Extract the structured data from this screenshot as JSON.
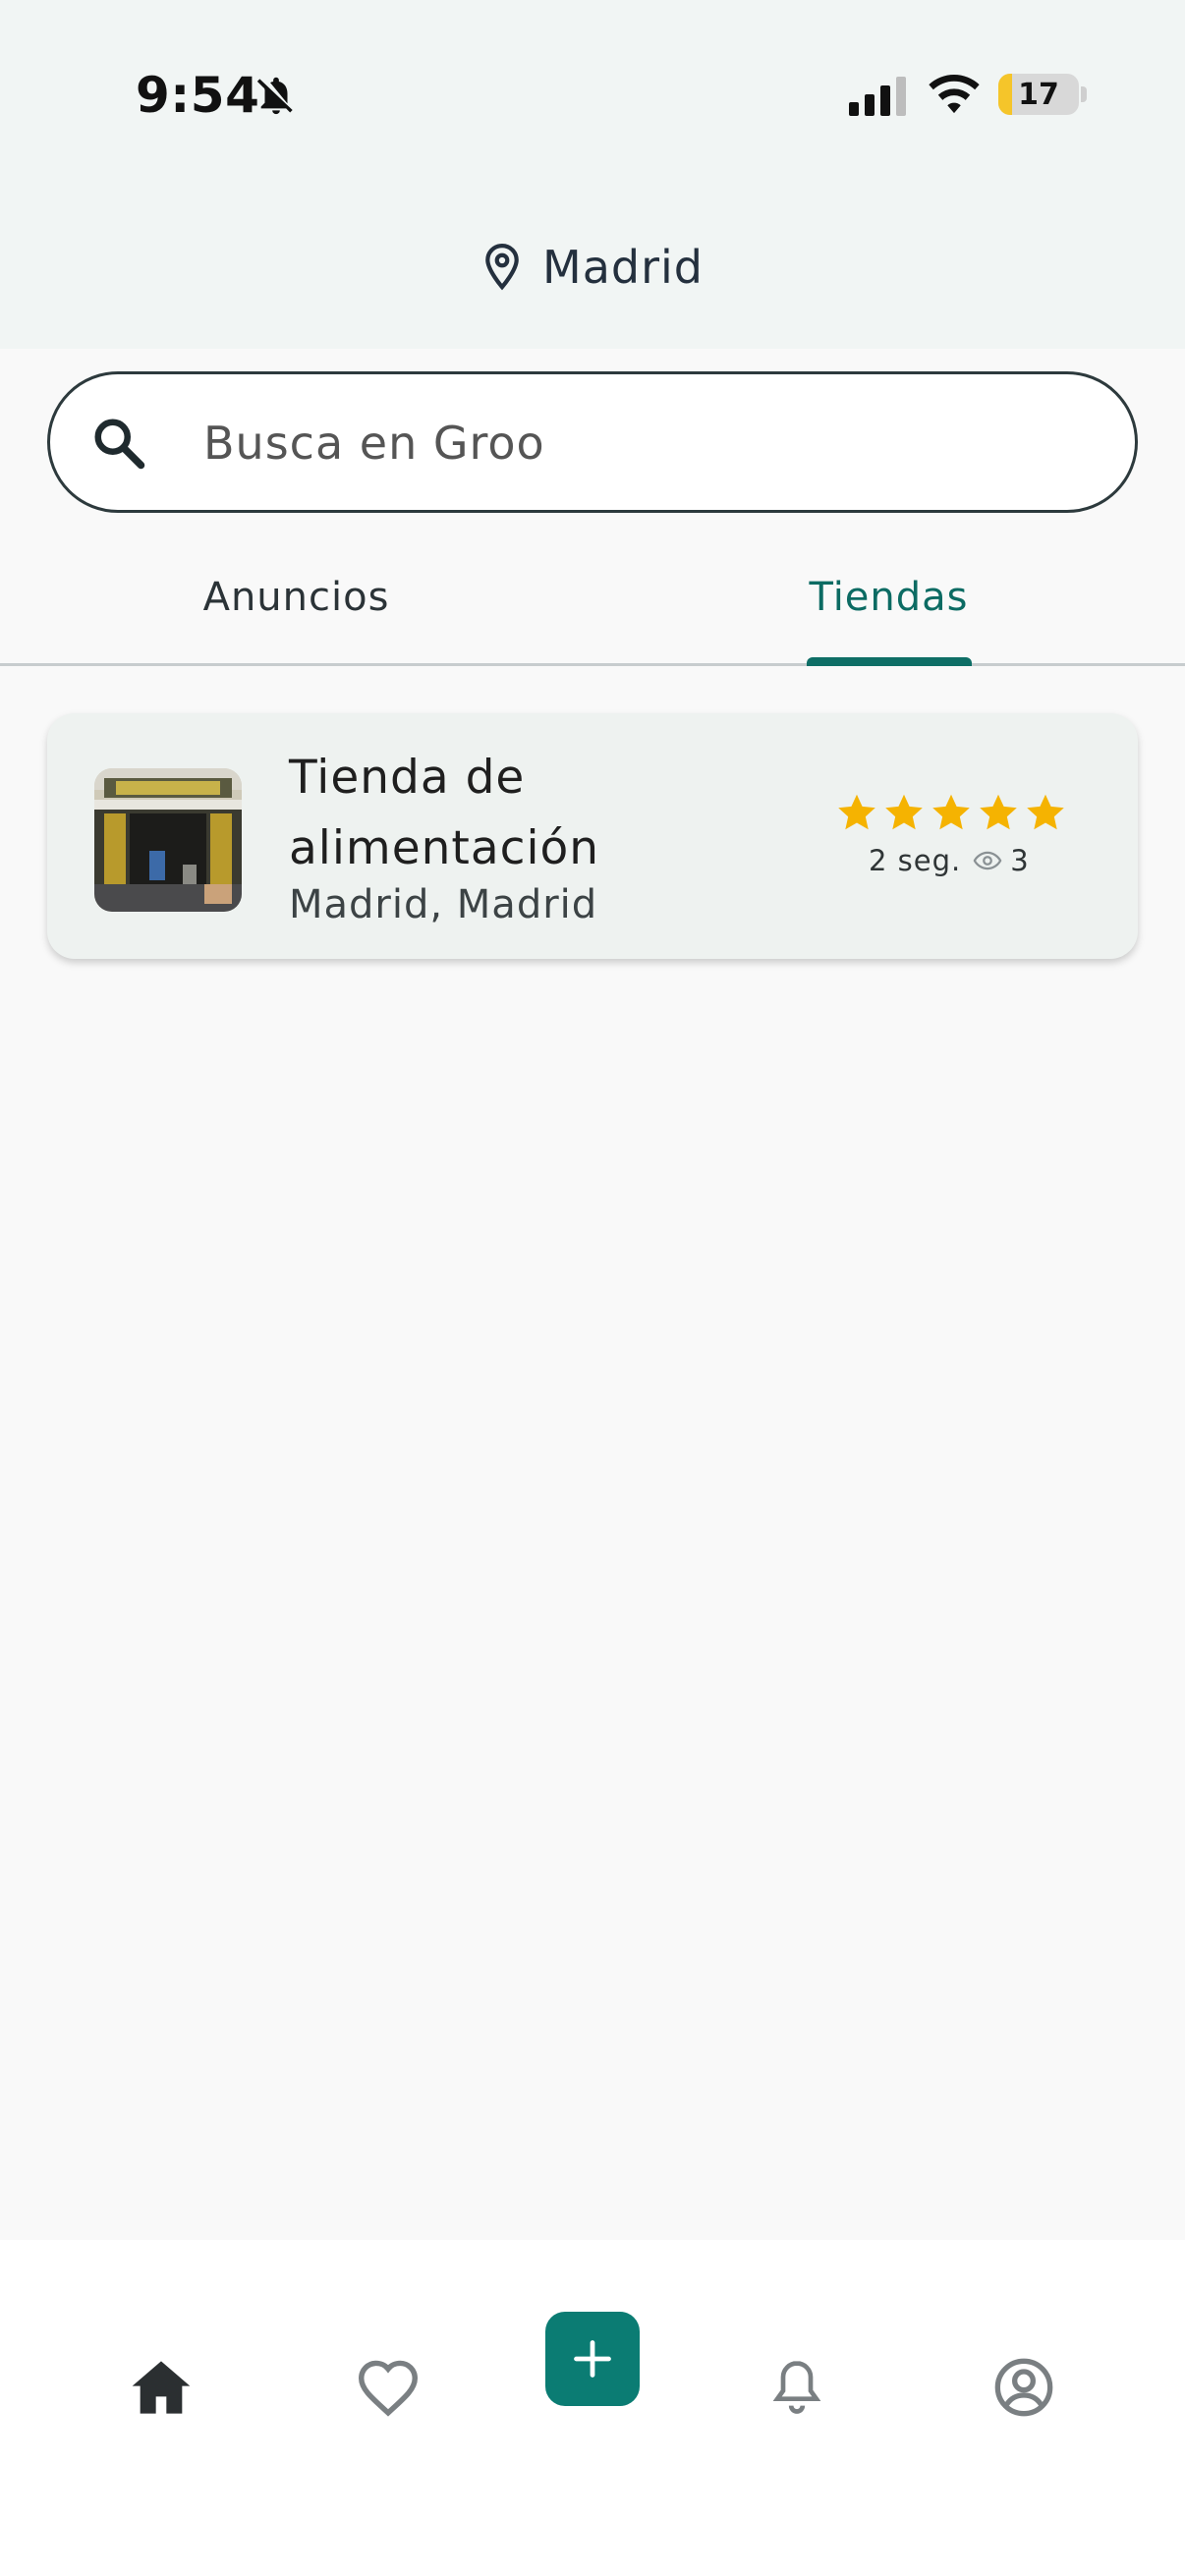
{
  "status_bar": {
    "time": "9:54",
    "battery_level": "17",
    "battery_fraction": 0.17
  },
  "header": {
    "location_icon": "map-pin-icon",
    "location_name": "Madrid"
  },
  "search": {
    "placeholder": "Busca en Groo",
    "icon": "search-icon"
  },
  "tabs": [
    {
      "label": "Anuncios",
      "selected": false
    },
    {
      "label": "Tiendas",
      "selected": true
    }
  ],
  "results": [
    {
      "title": "Tienda de alimentación",
      "location": "Madrid, Madrid",
      "rating": 5,
      "rating_max": 5,
      "time_ago": "2 seg.",
      "views": "3"
    }
  ],
  "bottom_nav": [
    {
      "name": "home",
      "icon": "home-icon",
      "active": true
    },
    {
      "name": "favorites",
      "icon": "heart-icon",
      "active": false
    },
    {
      "name": "add",
      "icon": "plus-icon",
      "active": false
    },
    {
      "name": "notifications",
      "icon": "bell-icon",
      "active": false
    },
    {
      "name": "profile",
      "icon": "user-circle-icon",
      "active": false
    }
  ],
  "colors": {
    "accent": "#0b7c73",
    "star": "#f5b301",
    "header_bg": "#f1f5f4",
    "card_bg": "#eef2f0"
  }
}
